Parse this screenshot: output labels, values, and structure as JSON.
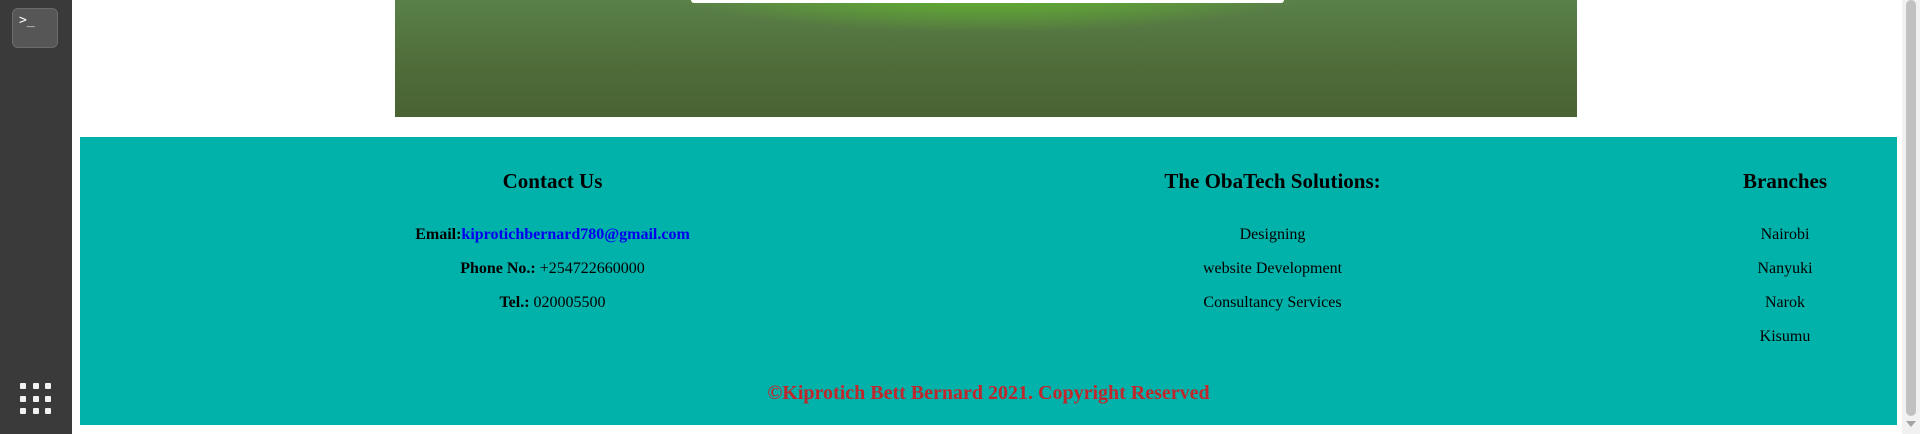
{
  "dock": {
    "terminal_label": ">_"
  },
  "footer": {
    "contact": {
      "heading": "Contact Us",
      "email_label": "Email:",
      "email_value": "kiprotichbernard780@gmail.com",
      "phone_label": "Phone No.:",
      "phone_value": " +254722660000",
      "tel_label": "Tel.:",
      "tel_value": " 020005500"
    },
    "solutions": {
      "heading": "The ObaTech Solutions:",
      "items": [
        "Designing",
        "website Development",
        "Consultancy Services"
      ]
    },
    "branches": {
      "heading": "Branches",
      "items": [
        "Nairobi",
        "Nanyuki",
        "Narok",
        "Kisumu"
      ]
    },
    "copyright": "©Kiprotich Bett Bernard 2021. Copyright Reserved"
  },
  "colors": {
    "footer_bg": "#00b2a9",
    "copyright_text": "#c0272d",
    "link": "#0000ee",
    "dock_bg": "#3a3a3a"
  }
}
